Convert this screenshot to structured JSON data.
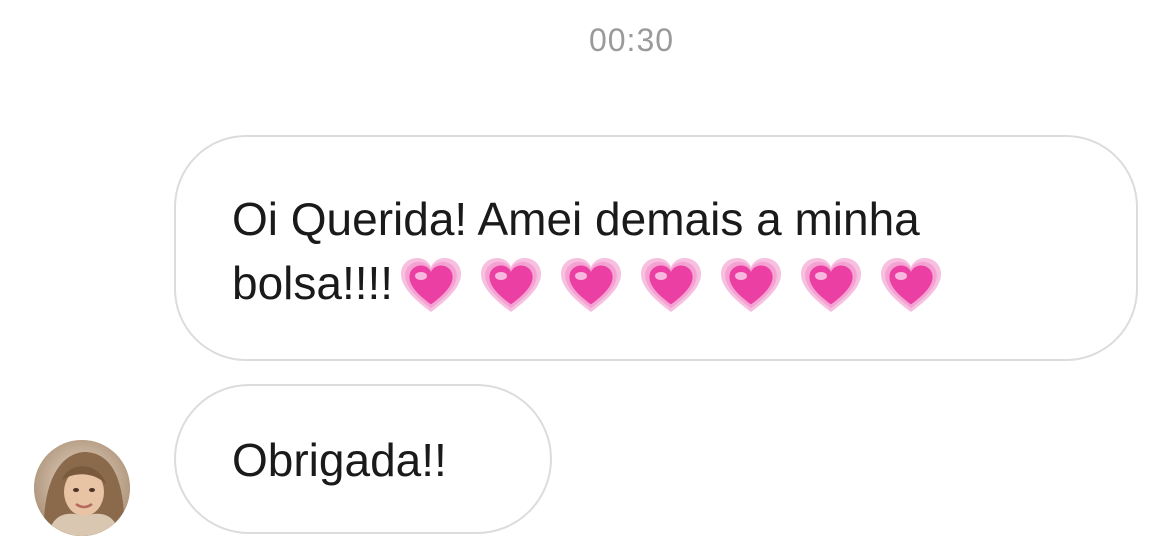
{
  "timestamp": "00:30",
  "messages": [
    {
      "line1": "Oi Querida! Amei demais a minha",
      "line2": "bolsa!!!!",
      "emoji": "growing-heart-icon",
      "emoji_count": 7,
      "emoji_color": "#ec3fa3"
    },
    {
      "text": "Obrigada!!"
    }
  ],
  "avatar": {
    "icon": "user-avatar-photo"
  }
}
